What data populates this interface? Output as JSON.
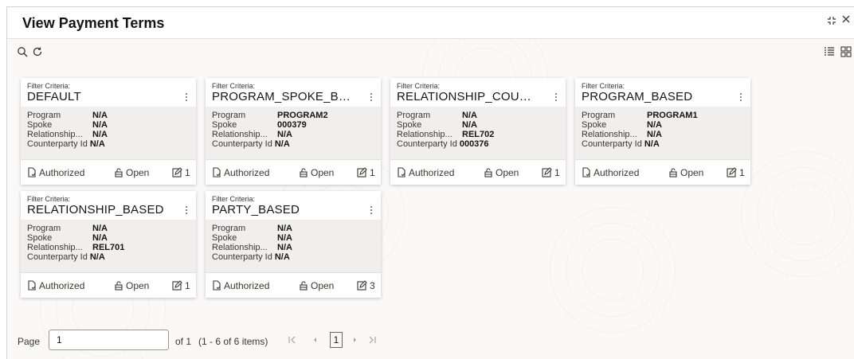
{
  "window": {
    "title": "View Payment Terms",
    "minimize_icon": "collapse-icon",
    "close_icon": "close-icon"
  },
  "toolbar": {
    "left_icons": [
      "search-icon",
      "refresh-icon"
    ],
    "right_icons": [
      "list-view-icon",
      "grid-view-icon"
    ]
  },
  "card_labels": {
    "filter_criteria": "Filter Criteria:",
    "program": "Program",
    "spoke": "Spoke",
    "relationship": "Relationship...",
    "counterparty": "Counterparty Id",
    "authorized": "Authorized",
    "open": "Open"
  },
  "cards": [
    {
      "name": "DEFAULT",
      "program": "N/A",
      "spoke": "N/A",
      "relationship": "N/A",
      "counterparty": "N/A",
      "versions": "1"
    },
    {
      "name": "PROGRAM_SPOKE_BASED",
      "program": "PROGRAM2",
      "spoke": "000379",
      "relationship": "N/A",
      "counterparty": "N/A",
      "versions": "1"
    },
    {
      "name": "RELATIONSHIP_COUNTE...",
      "program": "N/A",
      "spoke": "N/A",
      "relationship": "REL702",
      "counterparty": "000376",
      "versions": "1"
    },
    {
      "name": "PROGRAM_BASED",
      "program": "PROGRAM1",
      "spoke": "N/A",
      "relationship": "N/A",
      "counterparty": "N/A",
      "versions": "1"
    },
    {
      "name": "RELATIONSHIP_BASED",
      "program": "N/A",
      "spoke": "N/A",
      "relationship": "REL701",
      "counterparty": "N/A",
      "versions": "1"
    },
    {
      "name": "PARTY_BASED",
      "program": "N/A",
      "spoke": "N/A",
      "relationship": "N/A",
      "counterparty": "N/A",
      "versions": "3"
    }
  ],
  "pagination": {
    "page_label": "Page",
    "page_value": "1",
    "of_label": "of 1",
    "items_label": "(1 - 6 of 6 items)",
    "current_page": "1",
    "first_icon": "K<",
    "prev_icon": "◂",
    "next_icon": "▸",
    "last_icon": ">I"
  }
}
